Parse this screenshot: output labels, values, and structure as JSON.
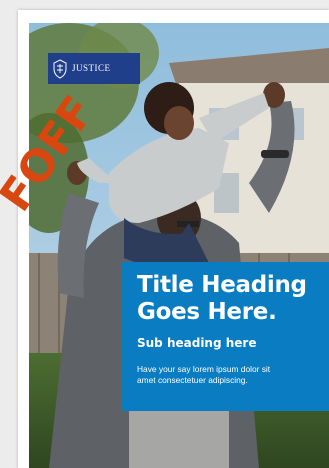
{
  "logo": {
    "name": "JUSTICE",
    "tagline": ""
  },
  "panel": {
    "title_line1": "Title Heading",
    "title_line2": "Goes Here.",
    "subheading": "Sub heading here",
    "body_line1": "Have your say lorem ipsum dolor sit",
    "body_line2": "amet consectetuer adipiscing."
  },
  "colors": {
    "panel_blue": "#0a7cc2",
    "logo_navy": "#1f3f8a",
    "stamp_orange": "#d8470f"
  },
  "icons": {
    "logo_mark": "crest-icon"
  }
}
